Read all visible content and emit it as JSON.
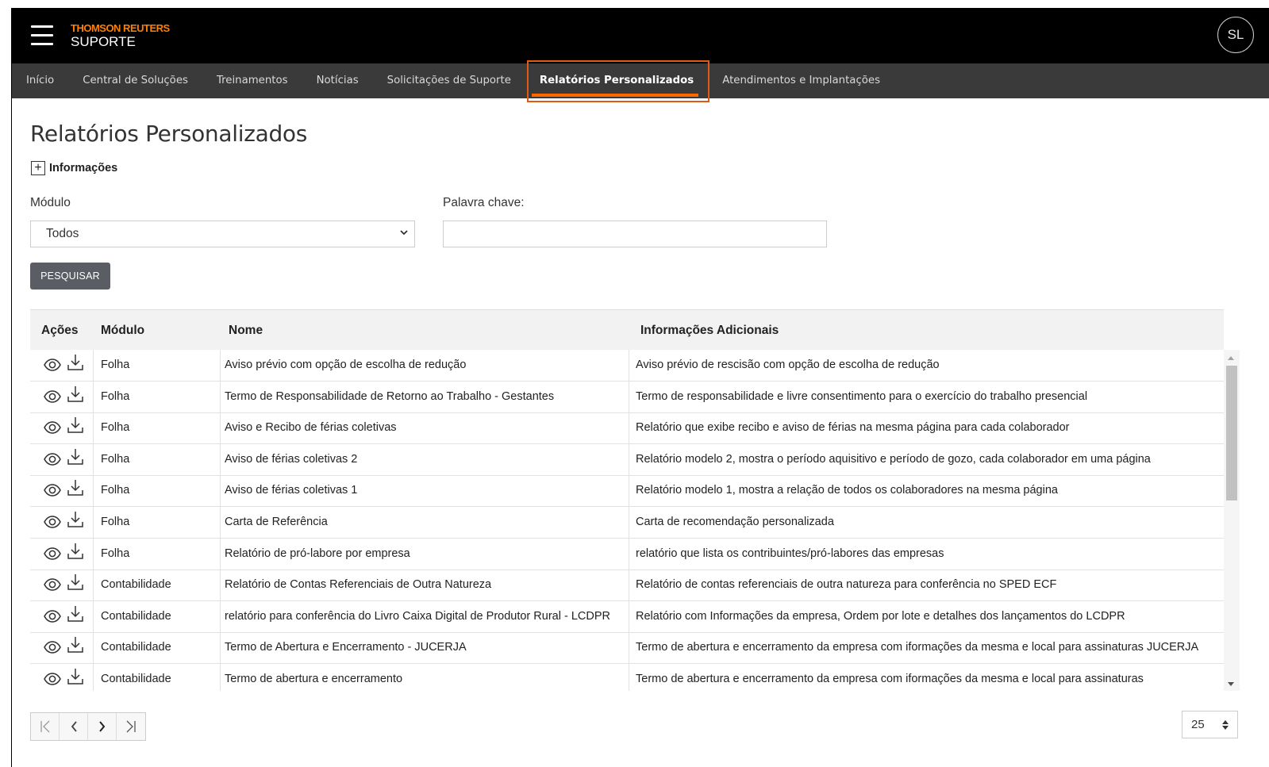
{
  "header": {
    "brand_top": "THOMSON REUTERS",
    "brand_sub": "SUPORTE",
    "avatar_initials": "SL",
    "brand_color": "#ff8000"
  },
  "nav": {
    "items": [
      {
        "label": "Início"
      },
      {
        "label": "Central de Soluções"
      },
      {
        "label": "Treinamentos"
      },
      {
        "label": "Notícias"
      },
      {
        "label": "Solicitações de Suporte"
      },
      {
        "label": "Relatórios Personalizados",
        "active": true
      },
      {
        "label": "Atendimentos e Implantações"
      }
    ],
    "active_color": "#ff6600",
    "highlight_color": "#e05a13"
  },
  "page": {
    "title": "Relatórios Personalizados",
    "info_toggle_label": "Informações"
  },
  "filters": {
    "module_label": "Módulo",
    "module_value": "Todos",
    "keyword_label": "Palavra chave:",
    "keyword_value": "",
    "search_button": "PESQUISAR"
  },
  "table": {
    "headers": {
      "actions": "Ações",
      "module": "Módulo",
      "name": "Nome",
      "info": "Informações Adicionais"
    },
    "rows": [
      {
        "module": "Folha",
        "name": "Aviso prévio com opção de escolha de redução",
        "info": "Aviso prévio de rescisão com opção de escolha de redução"
      },
      {
        "module": "Folha",
        "name": "Termo de Responsabilidade de Retorno ao Trabalho - Gestantes",
        "info": "Termo de responsabilidade e livre consentimento para o exercício do trabalho presencial"
      },
      {
        "module": "Folha",
        "name": "Aviso e Recibo de férias coletivas",
        "info": "Relatório que exibe recibo e aviso de férias na mesma página para cada colaborador"
      },
      {
        "module": "Folha",
        "name": "Aviso de férias coletivas 2",
        "info": "Relatório modelo 2, mostra o período aquisitivo e período de gozo, cada colaborador em uma página"
      },
      {
        "module": "Folha",
        "name": "Aviso de férias coletivas 1",
        "info": "Relatório modelo 1, mostra a relação de todos os colaboradores na mesma página"
      },
      {
        "module": "Folha",
        "name": "Carta de Referência",
        "info": "Carta de recomendação personalizada"
      },
      {
        "module": "Folha",
        "name": "Relatório de pró-labore por empresa",
        "info": "relatório que lista os contribuintes/pró-labores das empresas"
      },
      {
        "module": "Contabilidade",
        "name": "Relatório de Contas Referenciais de Outra Natureza",
        "info": "Relatório de contas referenciais de outra natureza para conferência no SPED ECF"
      },
      {
        "module": "Contabilidade",
        "name": "relatório para conferência do Livro Caixa Digital de Produtor Rural - LCDPR",
        "info": "Relatório com Informações da empresa, Ordem por lote e detalhes dos lançamentos do LCDPR"
      },
      {
        "module": "Contabilidade",
        "name": "Termo de Abertura e Encerramento - JUCERJA",
        "info": "Termo de abertura e encerramento da empresa com iformações da mesma e local para assinaturas JUCERJA"
      },
      {
        "module": "Contabilidade",
        "name": "Termo de abertura e encerramento",
        "info": "Termo de abertura e encerramento da empresa com iformações da mesma e local para assinaturas"
      }
    ],
    "row_icons": [
      "eye-icon",
      "download-icon"
    ]
  },
  "pagination": {
    "buttons": [
      "first-page-icon",
      "prev-page-icon",
      "next-page-icon",
      "last-page-icon"
    ],
    "per_page": "25"
  }
}
